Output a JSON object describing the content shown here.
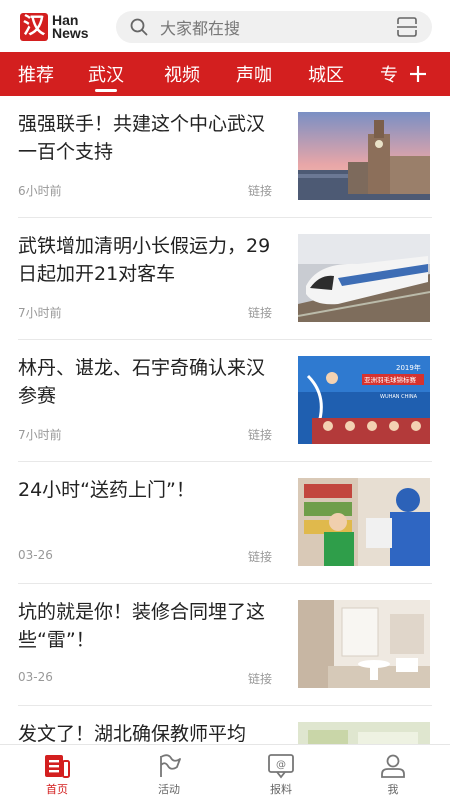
{
  "app": {
    "logo_mark": "汉",
    "logo_line1": "Han",
    "logo_line2": "News"
  },
  "search": {
    "placeholder": "大家都在搜"
  },
  "channels": [
    "推荐",
    "武汉",
    "视频",
    "声咖",
    "城区",
    "专"
  ],
  "active_channel": "武汉",
  "articles": [
    {
      "title": "强强联手！共建这个中心武汉一百个支持",
      "time": "6小时前",
      "link": "链接"
    },
    {
      "title": "武铁增加清明小长假运力，29日起加开21对客车",
      "time": "7小时前",
      "link": "链接"
    },
    {
      "title": "林丹、谌龙、石宇奇确认来汉参赛",
      "time": "7小时前",
      "link": "链接"
    },
    {
      "title": "24小时“送药上门”！",
      "time": "03-26",
      "link": "链接"
    },
    {
      "title": "坑的就是你！装修合同埋了这些“雷”！",
      "time": "03-26",
      "link": "链接"
    },
    {
      "title": "发文了！湖北确保教师平均",
      "time": "",
      "link": ""
    }
  ],
  "thumb3_text": {
    "year": "2019年",
    "name": "亚洲羽毛球锦标赛",
    "city": "WUHAN CHINA"
  },
  "tabs": [
    {
      "label": "首页",
      "icon": "news-icon"
    },
    {
      "label": "活动",
      "icon": "flag-icon"
    },
    {
      "label": "报料",
      "icon": "report-icon"
    },
    {
      "label": "我",
      "icon": "user-icon"
    }
  ],
  "colors": {
    "brand": "#d31f1f",
    "text": "#222222",
    "muted": "#999999"
  }
}
